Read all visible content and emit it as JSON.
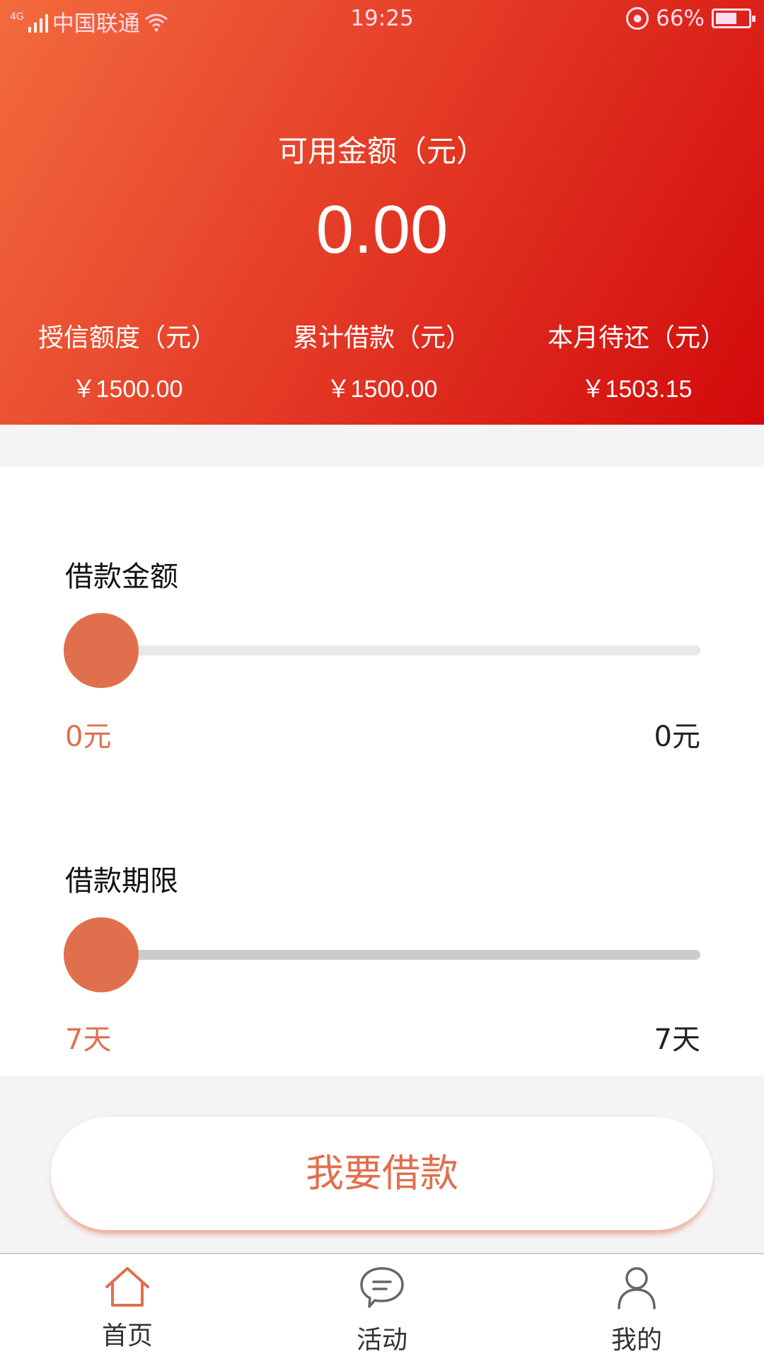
{
  "status_bar": {
    "network": "4G",
    "carrier": "中国联通",
    "time": "19:25",
    "battery": "66%",
    "battery_level": 0.66
  },
  "summary": {
    "available_label": "可用金额（元）",
    "available_amount": "0.00",
    "stats": [
      {
        "label": "授信额度（元）",
        "value": "￥1500.00"
      },
      {
        "label": "累计借款（元）",
        "value": "￥1500.00"
      },
      {
        "label": "本月待还（元）",
        "value": "￥1503.15"
      }
    ]
  },
  "loan_amount": {
    "title": "借款金额",
    "min_label": "0元",
    "max_label": "0元",
    "slider_fraction": 0
  },
  "loan_term": {
    "title": "借款期限",
    "min_label": "7天",
    "max_label": "7天",
    "slider_fraction": 0
  },
  "borrow_button": "我要借款",
  "tabs": [
    {
      "label": "首页",
      "icon": "home-icon",
      "active": true
    },
    {
      "label": "活动",
      "icon": "chat-bubble-icon",
      "active": false
    },
    {
      "label": "我的",
      "icon": "user-icon",
      "active": false
    }
  ],
  "colors": {
    "accent": "#e0704d",
    "header_start": "#f36b3e",
    "header_end": "#d2090b",
    "track_amount": "#e8e8e8",
    "track_term": "#cccccc"
  }
}
